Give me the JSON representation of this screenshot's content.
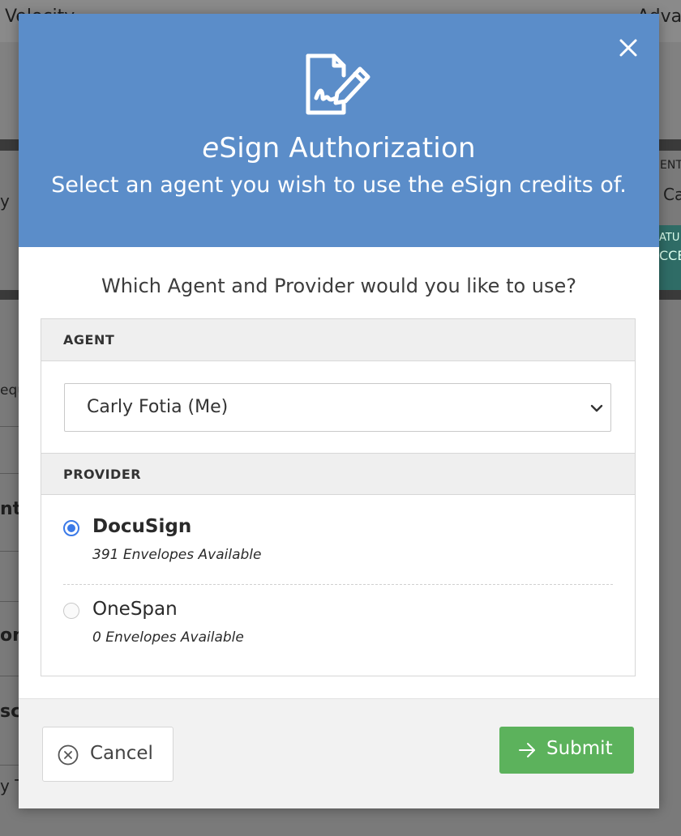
{
  "background": {
    "fragments": [
      "Velocity",
      "Advan",
      "y",
      "ENT",
      "Ca",
      "ATU",
      "CCE",
      "equ",
      "nt",
      "on",
      "sc",
      "y T"
    ]
  },
  "modal": {
    "title_prefix": "e",
    "title_rest": "Sign Authorization",
    "subtitle_before": "Select an agent you wish to use the ",
    "subtitle_e": "e",
    "subtitle_after": "Sign credits of.",
    "question": "Which Agent and Provider would you like to use?",
    "agent_section_label": "AGENT",
    "agent_selected": "Carly Fotia (Me)",
    "provider_section_label": "PROVIDER",
    "providers": [
      {
        "name": "DocuSign",
        "availability": "391 Envelopes Available",
        "selected": true
      },
      {
        "name": "OneSpan",
        "availability": "0 Envelopes Available",
        "selected": false
      }
    ],
    "cancel_label": "Cancel",
    "submit_label": "Submit"
  },
  "colors": {
    "header_blue": "#5b8dc9",
    "submit_green": "#5cb25c",
    "radio_blue": "#3b7ae8"
  },
  "icons": {
    "header": "signature-document-icon",
    "close": "close-icon",
    "chevron": "chevron-down-icon",
    "cancel": "circle-x-icon",
    "submit": "arrow-right-icon"
  }
}
